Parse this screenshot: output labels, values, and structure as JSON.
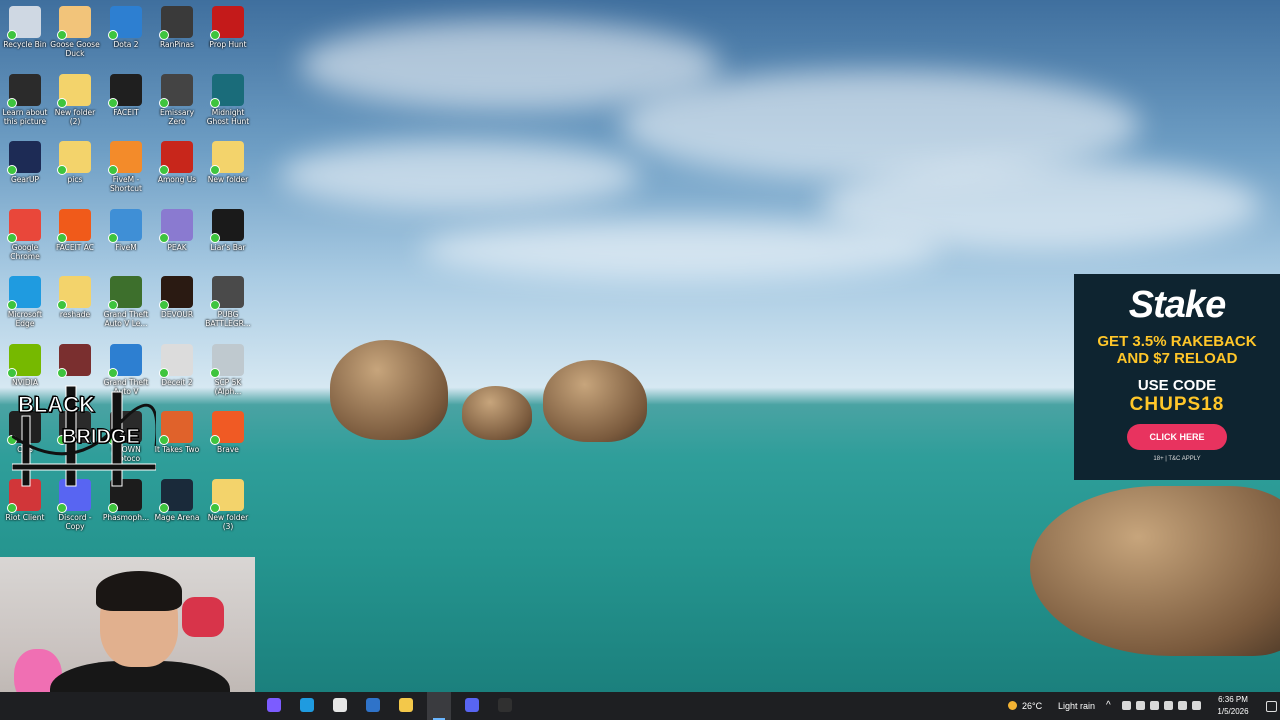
{
  "desktop": {
    "icons": [
      {
        "label": "Recycle Bin",
        "icon": "recycle-bin-icon",
        "color": "#cfd8e3"
      },
      {
        "label": "Goose Goose Duck",
        "icon": "goose-icon",
        "color": "#f2c47a"
      },
      {
        "label": "Dota 2",
        "icon": "ie-icon",
        "color": "#2d7fd1"
      },
      {
        "label": "RanPinas",
        "icon": "ranpinas-icon",
        "color": "#3a3a3a"
      },
      {
        "label": "Prop Hunt",
        "icon": "prop-hunt-icon",
        "color": "#c41a1a"
      },
      {
        "label": "Learn about this picture",
        "icon": "learn-picture-icon",
        "color": "#2b2b2b"
      },
      {
        "label": "New folder (2)",
        "icon": "folder-icon",
        "color": "#f3d36b"
      },
      {
        "label": "FACEIT",
        "icon": "faceit-icon",
        "color": "#1f1f1f"
      },
      {
        "label": "Emissary Zero",
        "icon": "emissary-zero-icon",
        "color": "#444444"
      },
      {
        "label": "Midnight Ghost Hunt",
        "icon": "midnight-ghost-icon",
        "color": "#1a6c7a"
      },
      {
        "label": "GearUP",
        "icon": "gearup-icon",
        "color": "#1d2b55"
      },
      {
        "label": "pics",
        "icon": "folder-icon",
        "color": "#f3d36b"
      },
      {
        "label": "FiveM - Shortcut",
        "icon": "fivem-icon",
        "color": "#f38b2a"
      },
      {
        "label": "Among Us",
        "icon": "among-us-icon",
        "color": "#c8261b"
      },
      {
        "label": "New folder",
        "icon": "folder-icon",
        "color": "#f3d36b"
      },
      {
        "label": "Google Chrome",
        "icon": "chrome-icon",
        "color": "#e9473a"
      },
      {
        "label": "FACEIT AC",
        "icon": "faceit-ac-icon",
        "color": "#f05a1a"
      },
      {
        "label": "FiveM",
        "icon": "fivem-window-icon",
        "color": "#3f8fd6"
      },
      {
        "label": "PEAK",
        "icon": "peak-icon",
        "color": "#8a7ad0"
      },
      {
        "label": "Liar's Bar",
        "icon": "liars-bar-icon",
        "color": "#1a1a1a"
      },
      {
        "label": "Microsoft Edge",
        "icon": "edge-icon",
        "color": "#1f9be0"
      },
      {
        "label": "reshade",
        "icon": "folder-icon",
        "color": "#f3d36b"
      },
      {
        "label": "Grand Theft Auto V Le...",
        "icon": "gta-v-icon",
        "color": "#3d6f2c"
      },
      {
        "label": "DEVOUR",
        "icon": "devour-icon",
        "color": "#2a1a12"
      },
      {
        "label": "PUBG BATTLEGR...",
        "icon": "pubg-icon",
        "color": "#4a4a4a"
      },
      {
        "label": "NVIDIA",
        "icon": "nvidia-icon",
        "color": "#76b900"
      },
      {
        "label": "",
        "icon": "game-icon",
        "color": "#7a2f2f"
      },
      {
        "label": "Grand Theft Auto V",
        "icon": "ie-icon",
        "color": "#2d7fd1"
      },
      {
        "label": "Deceit 2",
        "icon": "deceit-icon",
        "color": "#dcdcdc"
      },
      {
        "label": "SCP 5K (Alph...",
        "icon": "scp-icon",
        "color": "#bfc9cf"
      },
      {
        "label": "OBS",
        "icon": "obs-icon",
        "color": "#202020"
      },
      {
        "label": "",
        "icon": "game-icon",
        "color": "#2a2a2a"
      },
      {
        "label": "CROWN Protoco",
        "icon": "crown-icon",
        "color": "#2a2a2a"
      },
      {
        "label": "It Takes Two",
        "icon": "it-takes-two-icon",
        "color": "#e0622b"
      },
      {
        "label": "Brave",
        "icon": "brave-icon",
        "color": "#f05a24"
      },
      {
        "label": "Riot Client",
        "icon": "riot-icon",
        "color": "#d13639"
      },
      {
        "label": "Discord - Copy",
        "icon": "discord-icon",
        "color": "#5865f2"
      },
      {
        "label": "Phasmoph...",
        "icon": "phasmophobia-icon",
        "color": "#1c1c1c"
      },
      {
        "label": "Mage Arena",
        "icon": "mage-arena-icon",
        "color": "#1a2a3a"
      },
      {
        "label": "New folder (3)",
        "icon": "folder-icon",
        "color": "#f3d36b"
      }
    ]
  },
  "overlay_logo": {
    "line1": "BLACK",
    "line2": "BRIDGE"
  },
  "ad": {
    "brand": "Stake",
    "line1": "GET 3.5% RAKEBACK",
    "line2": "AND $7 RELOAD",
    "use_code": "USE CODE",
    "code": "CHUPS18",
    "button": "CLICK HERE",
    "terms": "18+ | T&C APPLY"
  },
  "taskbar": {
    "apps": [
      {
        "name": "copilot-icon",
        "color": "#7c5cff"
      },
      {
        "name": "edge-icon",
        "color": "#1f9be0"
      },
      {
        "name": "store-icon",
        "color": "#e6e6e6"
      },
      {
        "name": "outlook-icon",
        "color": "#2f73c9"
      },
      {
        "name": "file-explorer-icon",
        "color": "#f3c84a"
      },
      {
        "name": "chrome-icon",
        "color": "#e9473a"
      },
      {
        "name": "discord-icon",
        "color": "#5865f2"
      },
      {
        "name": "obs-icon",
        "color": "#303030"
      }
    ],
    "weather_temp": "26°C",
    "weather_desc": "Light rain",
    "time": "6:36 PM",
    "date": "1/5/2026"
  }
}
